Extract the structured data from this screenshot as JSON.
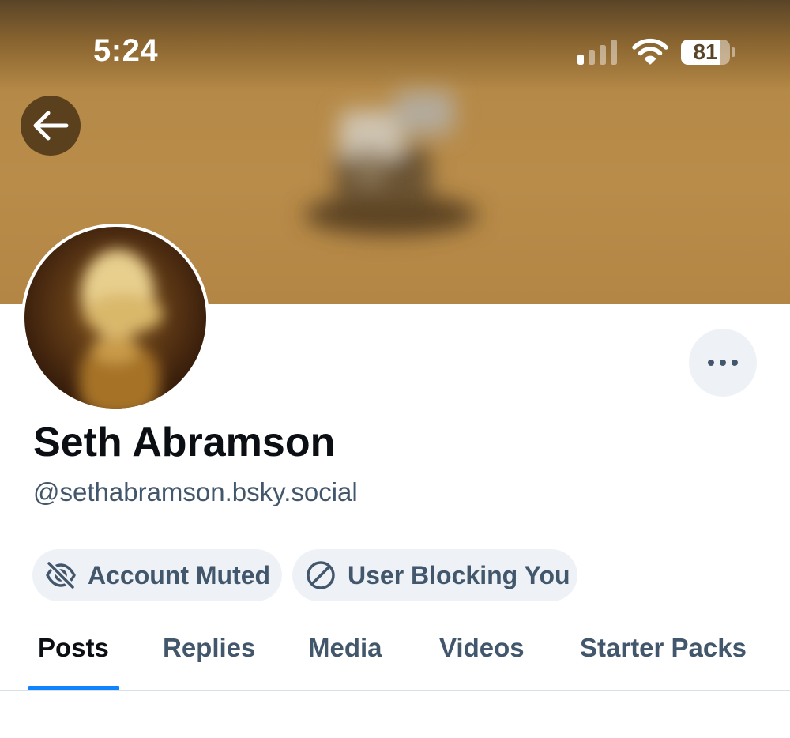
{
  "status_bar": {
    "time": "5:24",
    "battery_level": "81",
    "battery_fraction": 0.81,
    "signal_icon": "signal-bars-icon",
    "wifi_icon": "wifi-icon"
  },
  "header": {
    "back_icon": "arrow-left-icon"
  },
  "profile": {
    "display_name": "Seth Abramson",
    "handle": "@sethabramson.bsky.social",
    "more_icon": "ellipsis-icon"
  },
  "badges": [
    {
      "label": "Account Muted",
      "icon": "eye-slash-icon"
    },
    {
      "label": "User Blocking You",
      "icon": "block-circle-icon"
    }
  ],
  "tabs": [
    {
      "label": "Posts",
      "active": true
    },
    {
      "label": "Replies",
      "active": false
    },
    {
      "label": "Media",
      "active": false
    },
    {
      "label": "Videos",
      "active": false
    },
    {
      "label": "Starter Packs",
      "active": false
    }
  ],
  "colors": {
    "accent": "#1083fe",
    "text_primary": "#0b0f14",
    "text_secondary": "#42576c",
    "pill_background": "#eef2f6",
    "banner": "#b98c4a"
  }
}
